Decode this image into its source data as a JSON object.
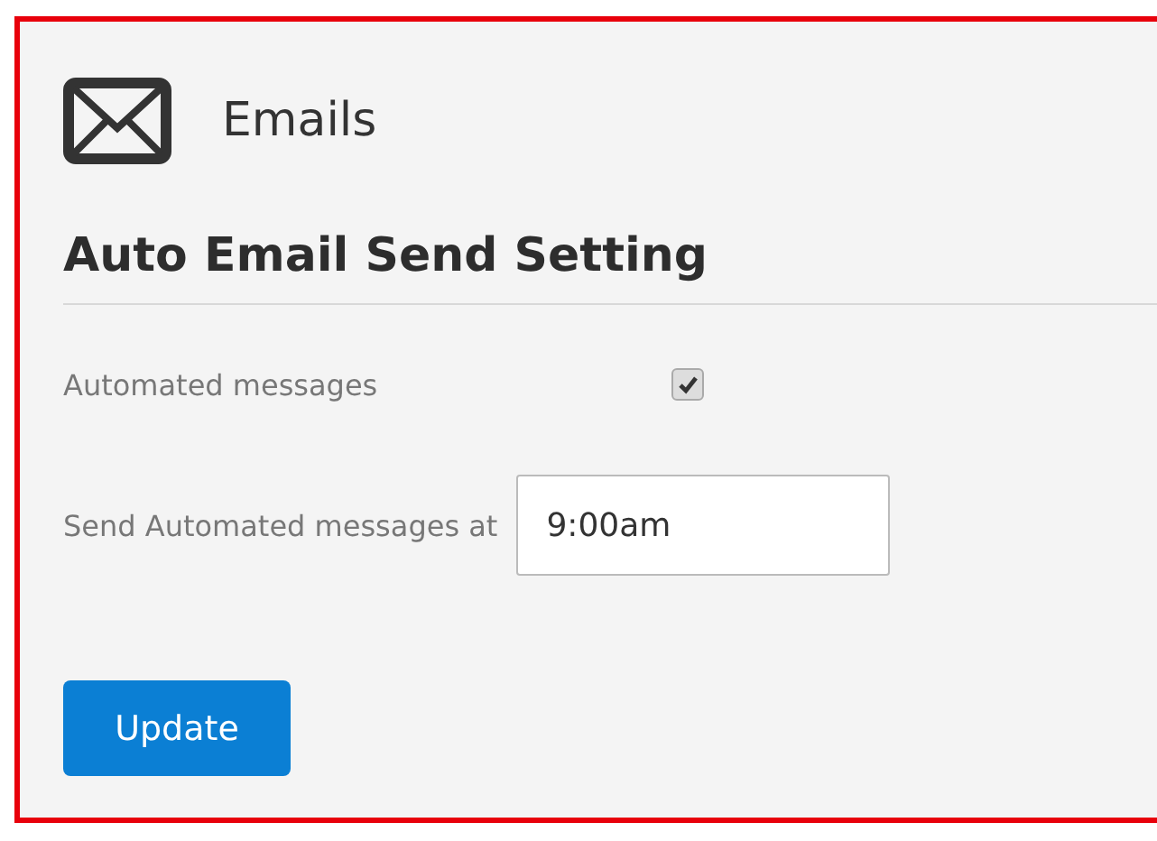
{
  "header": {
    "title": "Emails"
  },
  "section": {
    "heading": "Auto Email Send Setting"
  },
  "settings": [
    {
      "kind": "checkbox",
      "label": "Automated messages",
      "checked": true
    },
    {
      "kind": "text",
      "label": "Send Automated messages at",
      "value": "9:00am"
    }
  ],
  "buttons": [
    "Update"
  ]
}
